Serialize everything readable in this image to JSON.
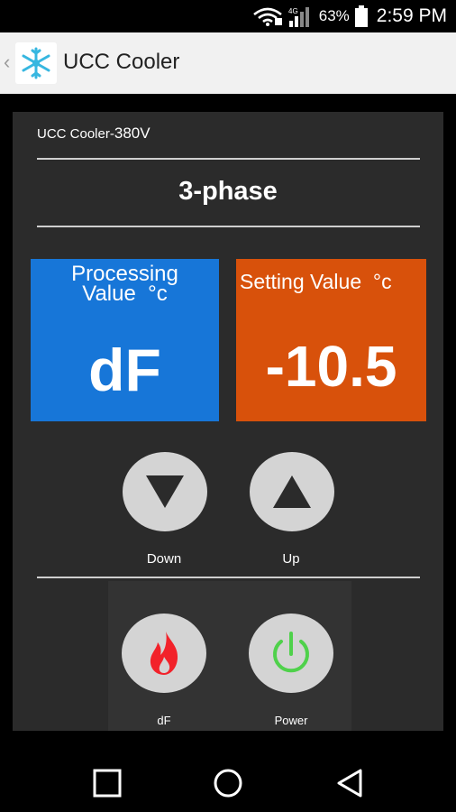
{
  "status_bar": {
    "battery_percent": "63%",
    "time": "2:59 PM",
    "icons": [
      "wifi-icon",
      "signal-icon",
      "battery-icon"
    ]
  },
  "app_bar": {
    "back_glyph": "‹",
    "title": "UCC Cooler",
    "icon": "snowflake-icon"
  },
  "panel": {
    "model_name": "UCC Cooler-",
    "model_voltage": "380V",
    "phase": "3-phase",
    "processing": {
      "label_line1": "Processing",
      "label_line2": "Value  °c",
      "value": "dF"
    },
    "setting": {
      "label": "Setting Value  °c",
      "value": "-10.5"
    },
    "buttons": {
      "down_label": "Down",
      "up_label": "Up",
      "df_label": "dF",
      "power_label": "Power"
    }
  },
  "colors": {
    "processing_bg": "#1776d8",
    "setting_bg": "#d8510b",
    "flame": "#f2222a",
    "power": "#4fd14b",
    "button": "#d4d4d4"
  },
  "nav_bar": {
    "icons": [
      "recent-apps-icon",
      "home-icon",
      "back-icon"
    ]
  }
}
